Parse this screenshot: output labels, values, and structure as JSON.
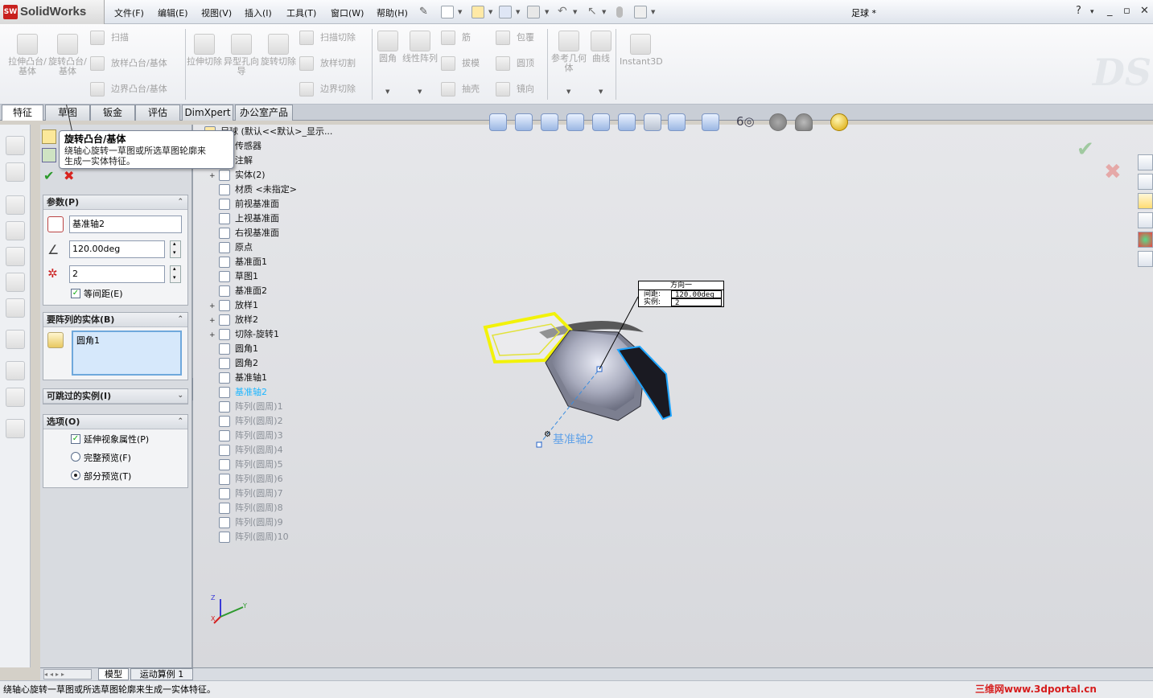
{
  "app": {
    "brand": "SolidWorks",
    "brand_short": "SW",
    "document_title": "足球 *"
  },
  "menu": [
    "文件(F)",
    "编辑(E)",
    "视图(V)",
    "插入(I)",
    "工具(T)",
    "窗口(W)",
    "帮助(H)"
  ],
  "window_buttons": [
    "?",
    "▾",
    "_",
    "▫",
    "✕"
  ],
  "command_manager": {
    "big_buttons": [
      {
        "label": "拉伸凸台/基体",
        "icon": "extrude-boss-icon"
      },
      {
        "label": "旋转凸台/基体",
        "icon": "revolve-boss-icon"
      },
      {
        "label": "拉伸切除",
        "icon": "extrude-cut-icon"
      },
      {
        "label": "异型孔向导",
        "icon": "hole-wizard-icon"
      },
      {
        "label": "旋转切除",
        "icon": "revolve-cut-icon"
      },
      {
        "label": "圆角",
        "icon": "fillet-icon"
      },
      {
        "label": "线性阵列",
        "icon": "linear-pattern-icon"
      },
      {
        "label": "参考几何体",
        "icon": "reference-geometry-icon"
      },
      {
        "label": "曲线",
        "icon": "curves-icon"
      },
      {
        "label": "Instant3D",
        "icon": "instant3d-icon"
      }
    ],
    "small_buttons": {
      "sweep": "扫描",
      "loft": "放样凸台/基体",
      "boundary": "边界凸台/基体",
      "swept_cut": "扫描切除",
      "lofted_cut": "放样切割",
      "boundary_cut": "边界切除",
      "rib": "筋",
      "draft": "拔模",
      "shell": "抽壳",
      "wrap": "包覆",
      "dome": "圆顶",
      "mirror": "镜向"
    }
  },
  "tabs": [
    "特征",
    "草图",
    "钣金",
    "评估",
    "DimXpert",
    "办公室产品"
  ],
  "tooltip": {
    "title": "旋转凸台/基体",
    "text_line1": "绕轴心旋转一草图或所选草图轮廓来",
    "text_line2": "生成一实体特征。"
  },
  "property_manager": {
    "groups": {
      "parameters": {
        "title": "参数(P)",
        "axis_value": "基准轴2",
        "angle_value": "120.00deg",
        "instances_value": "2",
        "equal_spacing_label": "等间距(E)",
        "equal_spacing_checked": true
      },
      "bodies": {
        "title": "要阵列的实体(B)",
        "items": [
          "圆角1"
        ]
      },
      "skip": {
        "title": "可跳过的实例(I)"
      },
      "options": {
        "title": "选项(O)",
        "extend_visual_label": "延伸视象属性(P)",
        "extend_visual_checked": true,
        "full_preview_label": "完整预览(F)",
        "partial_preview_label": "部分预览(T)",
        "preview_mode": "partial"
      }
    }
  },
  "feature_tree": {
    "root": "足球 (默认<<默认>_显示...",
    "items": [
      {
        "label": "传感器",
        "icon": "sensor-icon",
        "expand": false,
        "state": "normal"
      },
      {
        "label": "注解",
        "icon": "annotation-icon",
        "expand": false,
        "state": "normal"
      },
      {
        "label": "实体(2)",
        "icon": "solid-bodies-icon",
        "expand": true,
        "state": "normal"
      },
      {
        "label": "材质 <未指定>",
        "icon": "material-icon",
        "expand": false,
        "state": "normal"
      },
      {
        "label": "前视基准面",
        "icon": "plane-icon",
        "expand": false,
        "state": "normal"
      },
      {
        "label": "上视基准面",
        "icon": "plane-icon",
        "expand": false,
        "state": "normal"
      },
      {
        "label": "右视基准面",
        "icon": "plane-icon",
        "expand": false,
        "state": "normal"
      },
      {
        "label": "原点",
        "icon": "origin-icon",
        "expand": false,
        "state": "normal"
      },
      {
        "label": "基准面1",
        "icon": "plane-icon",
        "expand": false,
        "state": "normal"
      },
      {
        "label": "草图1",
        "icon": "sketch-icon",
        "expand": false,
        "state": "normal"
      },
      {
        "label": "基准面2",
        "icon": "plane-icon",
        "expand": false,
        "state": "normal"
      },
      {
        "label": "放样1",
        "icon": "loft-icon",
        "expand": true,
        "state": "normal"
      },
      {
        "label": "放样2",
        "icon": "loft-icon",
        "expand": true,
        "state": "normal"
      },
      {
        "label": "切除-旋转1",
        "icon": "cut-revolve-icon",
        "expand": true,
        "state": "normal"
      },
      {
        "label": "圆角1",
        "icon": "fillet-icon",
        "expand": false,
        "state": "normal"
      },
      {
        "label": "圆角2",
        "icon": "fillet-icon",
        "expand": false,
        "state": "normal"
      },
      {
        "label": "基准轴1",
        "icon": "axis-icon",
        "expand": false,
        "state": "normal"
      },
      {
        "label": "基准轴2",
        "icon": "axis-icon",
        "expand": false,
        "state": "selected"
      },
      {
        "label": "阵列(圆周)1",
        "icon": "circular-pattern-icon",
        "expand": false,
        "state": "dim"
      },
      {
        "label": "阵列(圆周)2",
        "icon": "circular-pattern-icon",
        "expand": false,
        "state": "dim"
      },
      {
        "label": "阵列(圆周)3",
        "icon": "circular-pattern-icon",
        "expand": false,
        "state": "dim"
      },
      {
        "label": "阵列(圆周)4",
        "icon": "circular-pattern-icon",
        "expand": false,
        "state": "dim"
      },
      {
        "label": "阵列(圆周)5",
        "icon": "circular-pattern-icon",
        "expand": false,
        "state": "dim"
      },
      {
        "label": "阵列(圆周)6",
        "icon": "circular-pattern-icon",
        "expand": false,
        "state": "dim"
      },
      {
        "label": "阵列(圆周)7",
        "icon": "circular-pattern-icon",
        "expand": false,
        "state": "dim"
      },
      {
        "label": "阵列(圆周)8",
        "icon": "circular-pattern-icon",
        "expand": false,
        "state": "dim"
      },
      {
        "label": "阵列(圆周)9",
        "icon": "circular-pattern-icon",
        "expand": false,
        "state": "dim"
      },
      {
        "label": "阵列(圆周)10",
        "icon": "circular-pattern-icon",
        "expand": false,
        "state": "dim"
      }
    ]
  },
  "callout": {
    "title": "方向一",
    "spacing_label": "间距:",
    "spacing_value": "120.00deg",
    "instances_label": "实例:",
    "instances_value": "2"
  },
  "axis_label": "基准轴2",
  "triad": {
    "x": "X",
    "y": "Y",
    "z": "Z"
  },
  "bottom_tabs": [
    "模型",
    "运动算例 1"
  ],
  "status_text": "绕轴心旋转一草图或所选草图轮廓来生成一实体特征。",
  "watermark": "三维网www.3dportal.cn",
  "colors": {
    "selection_yellow": "#f2f20a",
    "selection_blue": "#1fa5ff",
    "tree_selected": "#1fb7ff",
    "confirm_green": "#2c9a2c",
    "cancel_red": "#d9231f"
  }
}
